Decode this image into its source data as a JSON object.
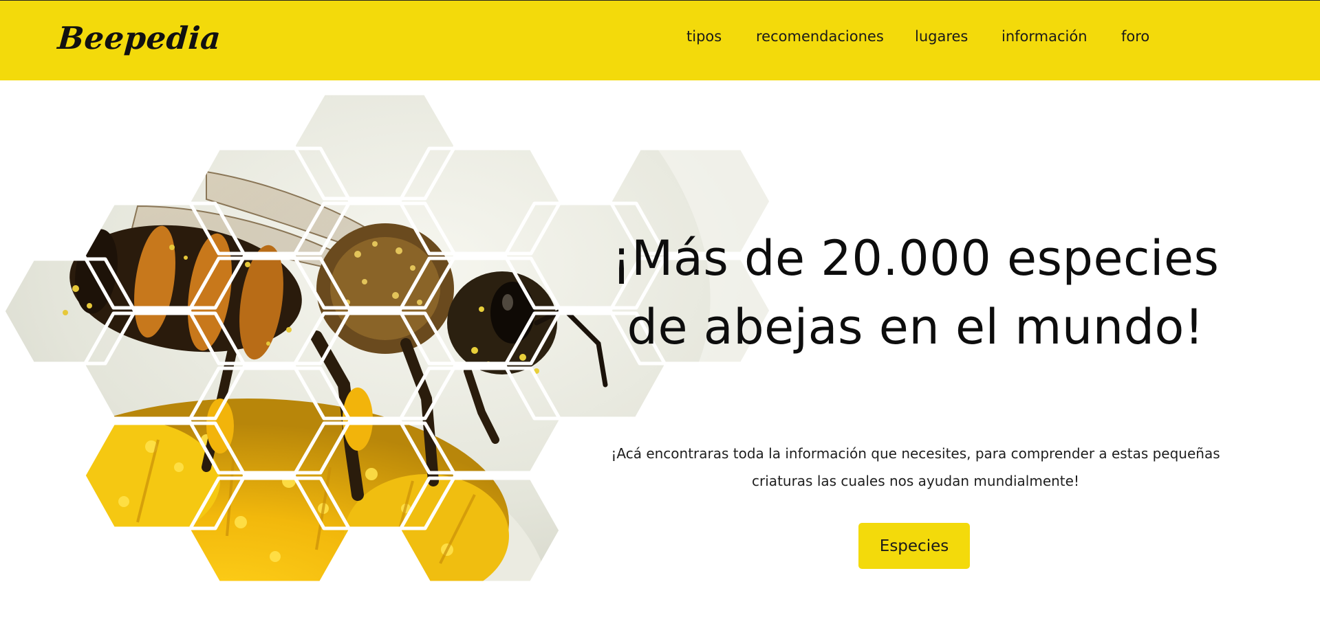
{
  "header": {
    "brand": "Beepedia",
    "nav": [
      {
        "label": "tipos"
      },
      {
        "label": "recomendaciones"
      },
      {
        "label": "lugares"
      },
      {
        "label": "información"
      },
      {
        "label": "foro"
      }
    ]
  },
  "hero": {
    "title": "¡Más de 20.000 especies de abejas en el mundo!",
    "subtitle": "¡Acá encontraras toda la información que necesites, para comprender a estas pequeñas criaturas las cuales nos ayudan mundialmente!",
    "cta_label": "Especies",
    "image_subject": "bee-on-flower-honeycomb-collage"
  },
  "colors": {
    "brand_yellow": "#f3da0b",
    "text_dark": "#0d0d0d",
    "background": "#ffffff"
  }
}
